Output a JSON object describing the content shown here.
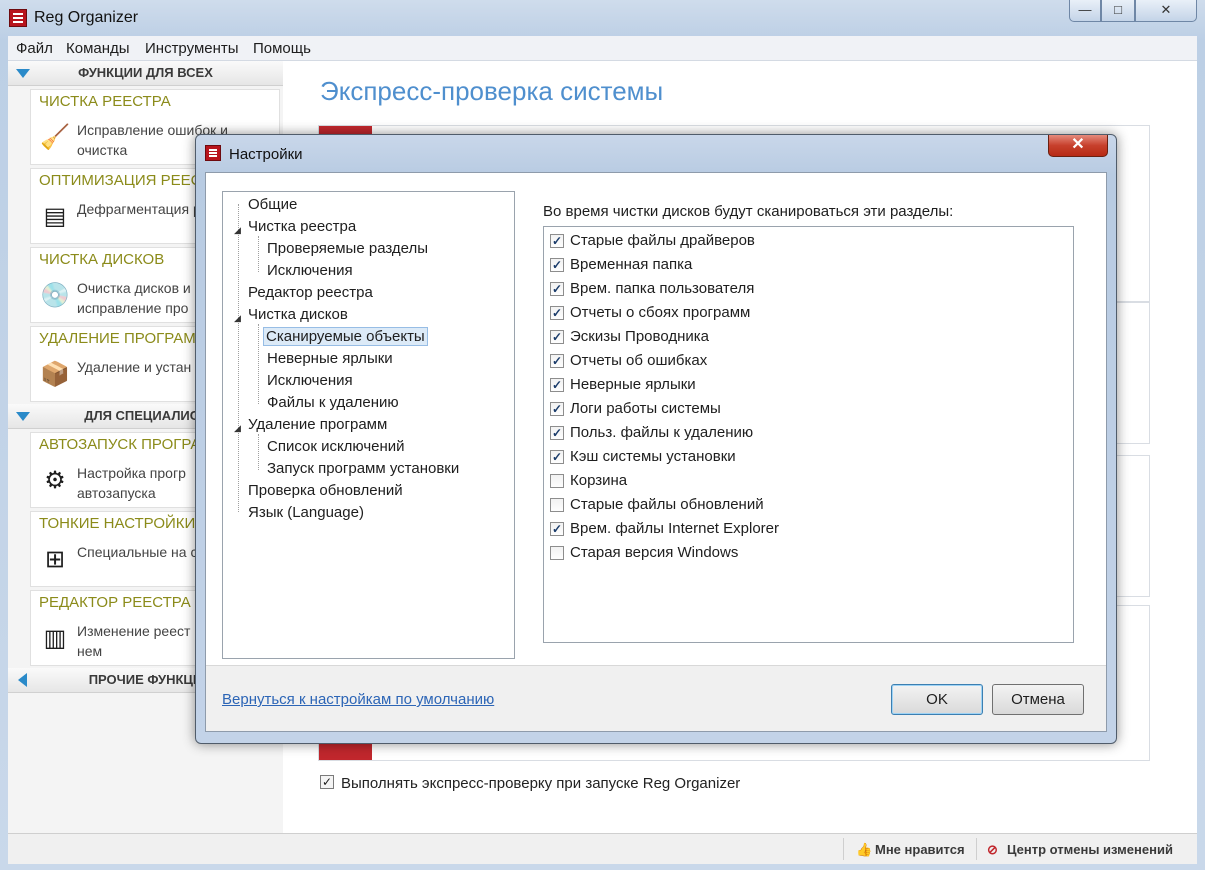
{
  "app": {
    "title": "Reg Organizer",
    "min_glyph": "—",
    "max_glyph": "□",
    "close_glyph": "✕"
  },
  "menu": [
    "Файл",
    "Команды",
    "Инструменты",
    "Помощь"
  ],
  "sidebar": {
    "groups": [
      {
        "label": "ФУНКЦИИ ДЛЯ ВСЕХ",
        "state": "expanded"
      },
      {
        "label": "ДЛЯ СПЕЦИАЛИСТ",
        "state": "expanded"
      },
      {
        "label": "ПРОЧИЕ ФУНКЦИ",
        "state": "collapsed"
      }
    ],
    "cards": [
      {
        "title": "ЧИСТКА РЕЕСТРА",
        "text": "Исправление ошибок и очистка",
        "icon": "registry-cleanup-icon"
      },
      {
        "title": "ОПТИМИЗАЦИЯ РЕЕС",
        "text": "Дефрагментация реестра",
        "icon": "defrag-icon"
      },
      {
        "title": "ЧИСТКА ДИСКОВ",
        "text": "Очистка дисков и исправление про",
        "icon": "disk-cleanup-icon"
      },
      {
        "title": "УДАЛЕНИЕ ПРОГРАМ",
        "text": "Удаление и устан программ",
        "icon": "uninstall-icon"
      },
      {
        "title": "АВТОЗАПУСК ПРОГРА",
        "text": "Настройка прогр автозапуска",
        "icon": "autorun-icon"
      },
      {
        "title": "ТОНКИЕ НАСТРОЙКИ",
        "text": "Специальные на системы",
        "icon": "tweaks-icon"
      },
      {
        "title": "РЕДАКТОР РЕЕСТРА",
        "text": "Изменение реест поиск в нем",
        "icon": "registry-editor-icon"
      }
    ]
  },
  "content": {
    "title": "Экспресс-проверка системы",
    "startup_check_label": "Выполнять экспресс-проверку при запуске Reg Organizer",
    "startup_checked": true
  },
  "status_bar": {
    "like": "Мне нравится",
    "undo_center": "Центр отмены изменений"
  },
  "dialog": {
    "title": "Настройки",
    "close_glyph": "✕",
    "tree": [
      {
        "label": "Общие",
        "level": 0
      },
      {
        "label": "Чистка реестра",
        "level": 0,
        "expanded": true
      },
      {
        "label": "Проверяемые разделы",
        "level": 1
      },
      {
        "label": "Исключения",
        "level": 1
      },
      {
        "label": "Редактор реестра",
        "level": 0
      },
      {
        "label": "Чистка дисков",
        "level": 0,
        "expanded": true
      },
      {
        "label": "Сканируемые объекты",
        "level": 1,
        "selected": true
      },
      {
        "label": "Неверные ярлыки",
        "level": 1
      },
      {
        "label": "Исключения",
        "level": 1
      },
      {
        "label": "Файлы к удалению",
        "level": 1
      },
      {
        "label": "Удаление программ",
        "level": 0,
        "expanded": true
      },
      {
        "label": "Список исключений",
        "level": 1
      },
      {
        "label": "Запуск программ установки",
        "level": 1
      },
      {
        "label": "Проверка обновлений",
        "level": 0
      },
      {
        "label": "Язык (Language)",
        "level": 0
      }
    ],
    "checklist_caption": "Во время чистки дисков будут сканироваться эти разделы:",
    "checklist": [
      {
        "label": "Старые файлы драйверов",
        "checked": true
      },
      {
        "label": "Временная папка",
        "checked": true
      },
      {
        "label": "Врем. папка пользователя",
        "checked": true
      },
      {
        "label": "Отчеты о сбоях программ",
        "checked": true
      },
      {
        "label": "Эскизы Проводника",
        "checked": true
      },
      {
        "label": "Отчеты об ошибках",
        "checked": true
      },
      {
        "label": "Неверные ярлыки",
        "checked": true
      },
      {
        "label": "Логи работы системы",
        "checked": true
      },
      {
        "label": "Польз. файлы к удалению",
        "checked": true
      },
      {
        "label": "Кэш системы установки",
        "checked": true
      },
      {
        "label": "Корзина",
        "checked": false
      },
      {
        "label": "Старые файлы обновлений",
        "checked": false
      },
      {
        "label": "Врем. файлы Internet Explorer",
        "checked": true
      },
      {
        "label": "Старая версия Windows",
        "checked": false
      }
    ],
    "reset_link": "Вернуться к настройкам по умолчанию",
    "ok_label": "OK",
    "cancel_label": "Отмена"
  },
  "colors": {
    "accent_red": "#c1272d",
    "title_blue": "#4f8fce",
    "card_title": "#8b8b1a",
    "link_blue": "#2c65b6"
  }
}
